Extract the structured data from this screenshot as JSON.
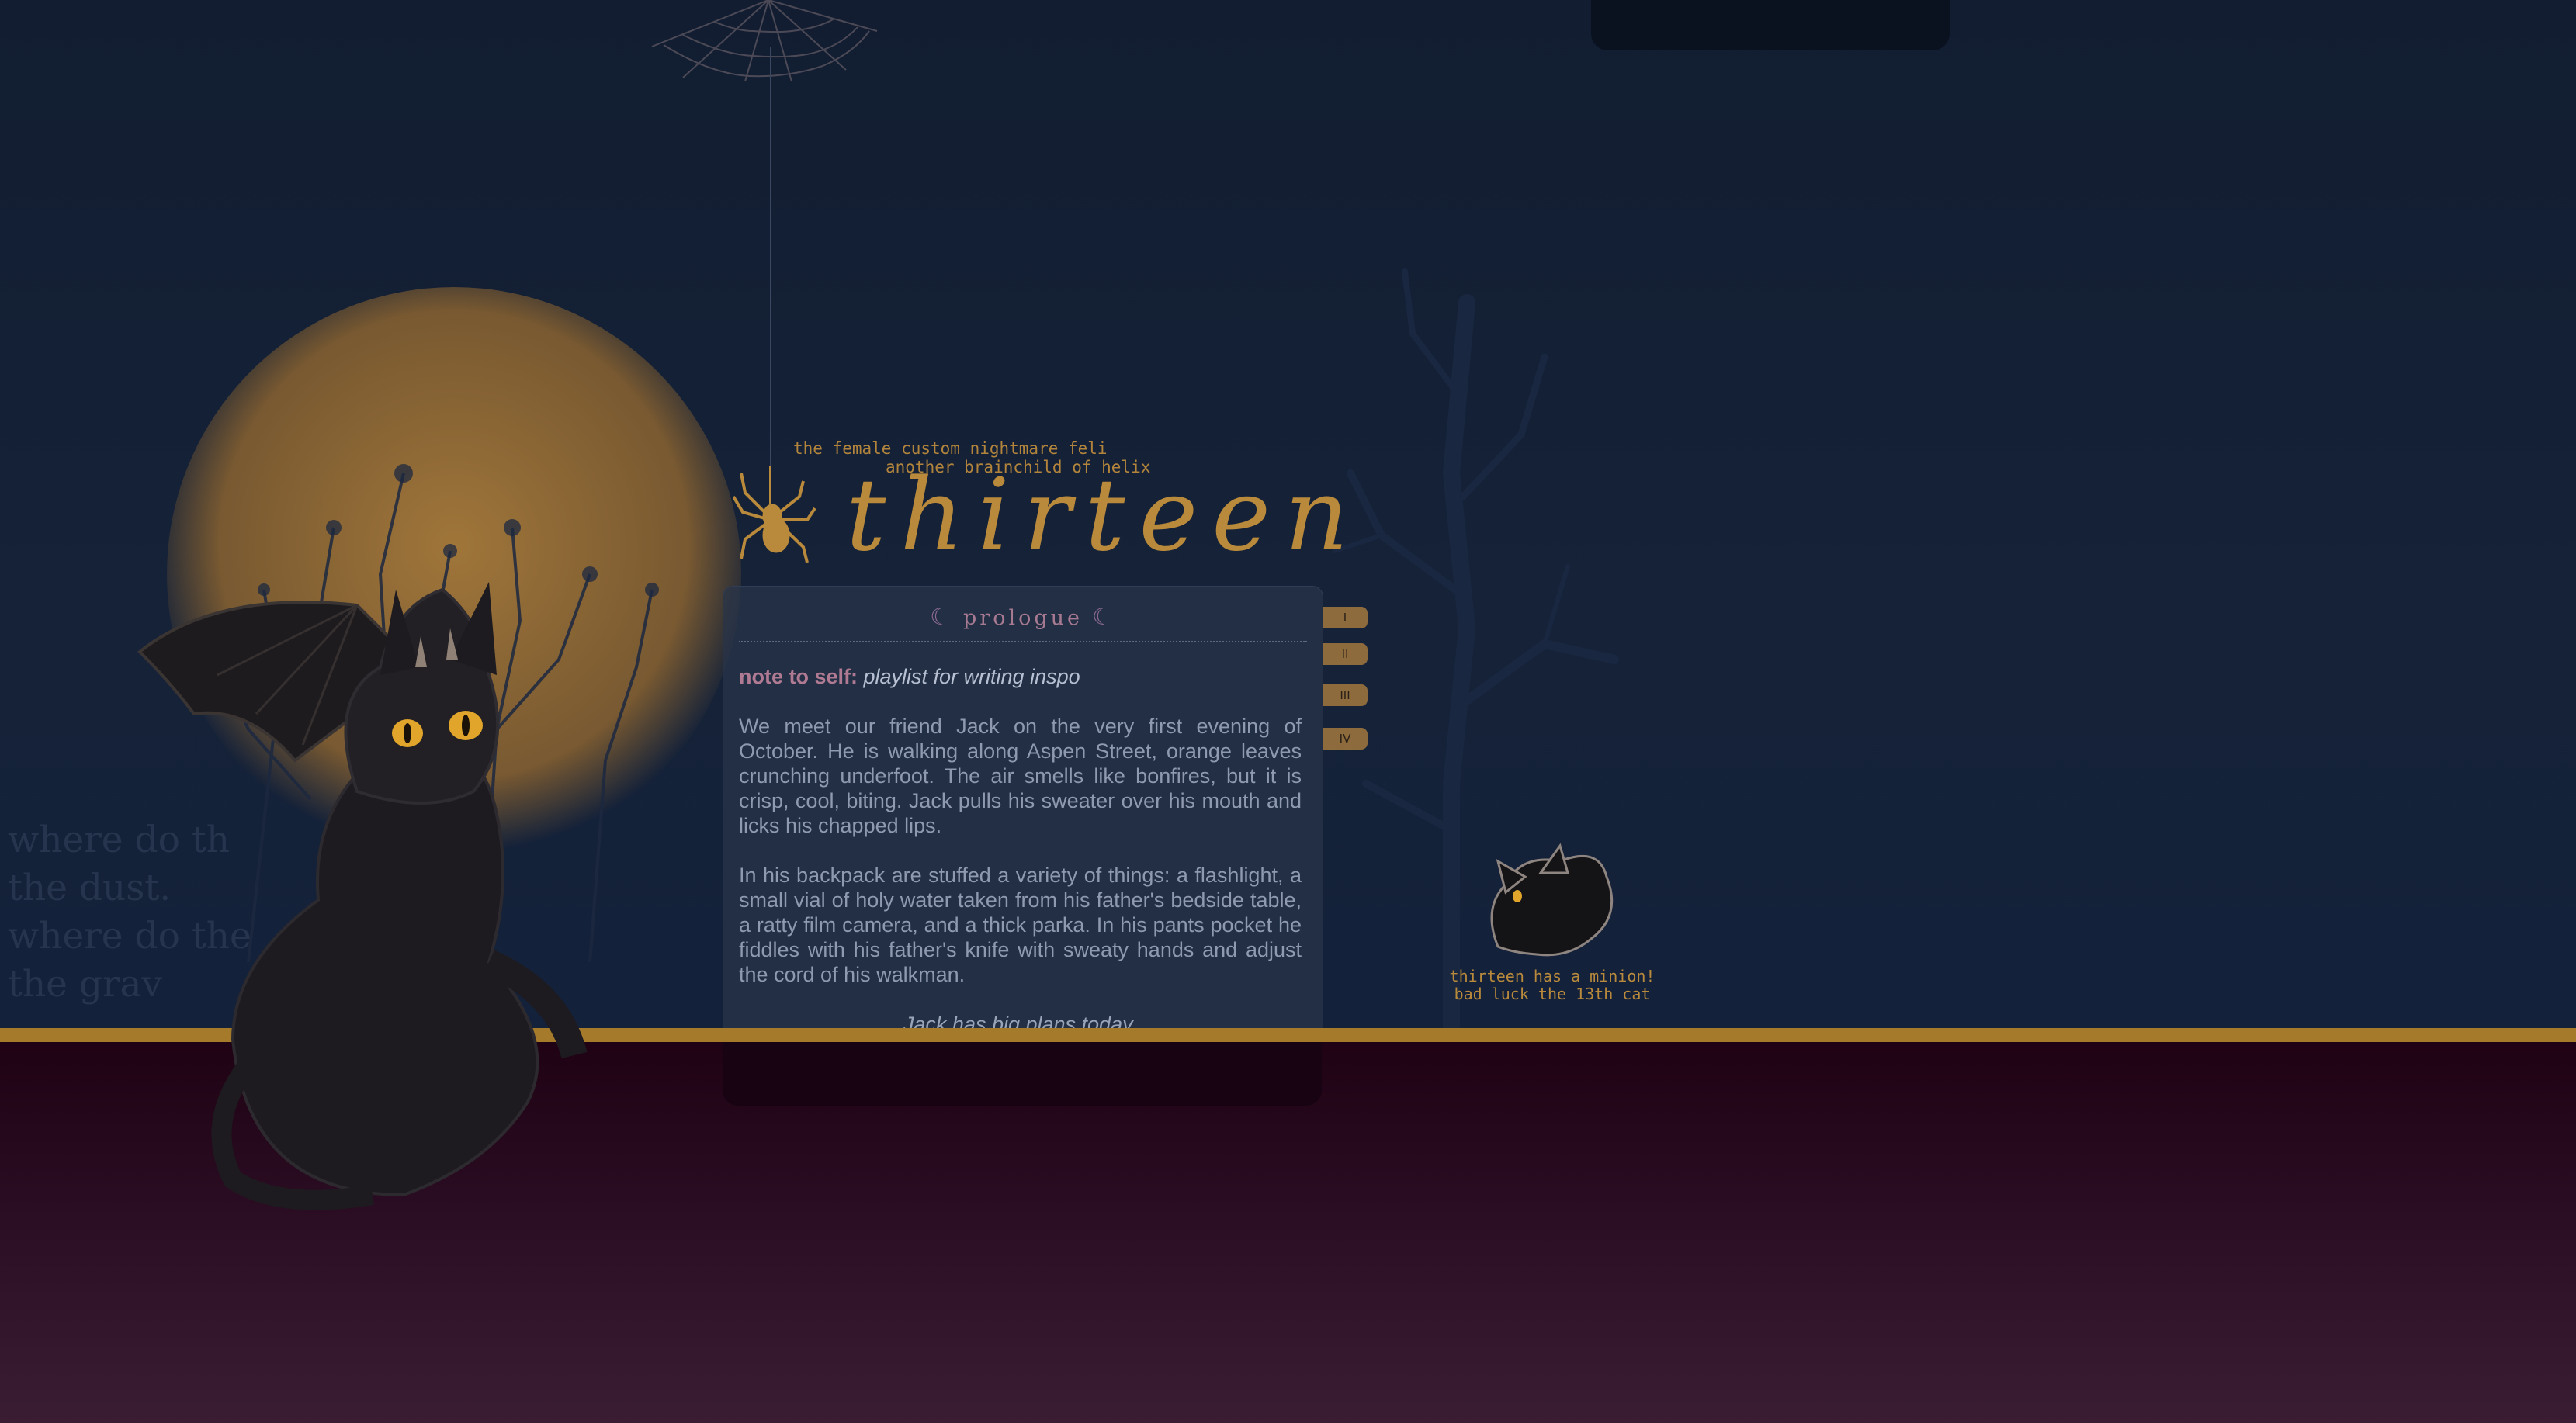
{
  "header": {
    "tagline_1": "the female custom nightmare feli",
    "tagline_2": "another brainchild of helix",
    "title": "thirteen"
  },
  "background": {
    "poem": "where do th\nthe dust.\nwhere do the\nthe grav"
  },
  "panel": {
    "heading": "prologue",
    "note_label": "note to self:",
    "note_text": "playlist for writing inspo",
    "paragraph_1": "We meet our friend Jack on the very first evening of October. He is walking along Aspen Street, orange leaves crunching underfoot. The air smells like bonfires, but it is crisp, cool, biting. Jack pulls his sweater over his mouth and licks his chapped lips.",
    "paragraph_2": "In his backpack are stuffed a variety of things: a flashlight, a small vial of holy water taken from his father's bedside table, a ratty film camera, and a thick parka. In his pants pocket he fiddles with his father's knife with sweaty hands and adjust the cord of his walkman.",
    "closing_line": "Jack has big plans today."
  },
  "side_tabs": [
    {
      "label": "I"
    },
    {
      "label": "II"
    },
    {
      "label": "III"
    },
    {
      "label": "IV"
    }
  ],
  "minion": {
    "caption_1": "thirteen has a minion!",
    "caption_2": "bad luck the 13th cat"
  },
  "colors": {
    "gold": "#b98a3b",
    "navy": "#131f33",
    "plum": "#2a0c22",
    "mauve": "#b07a93"
  }
}
